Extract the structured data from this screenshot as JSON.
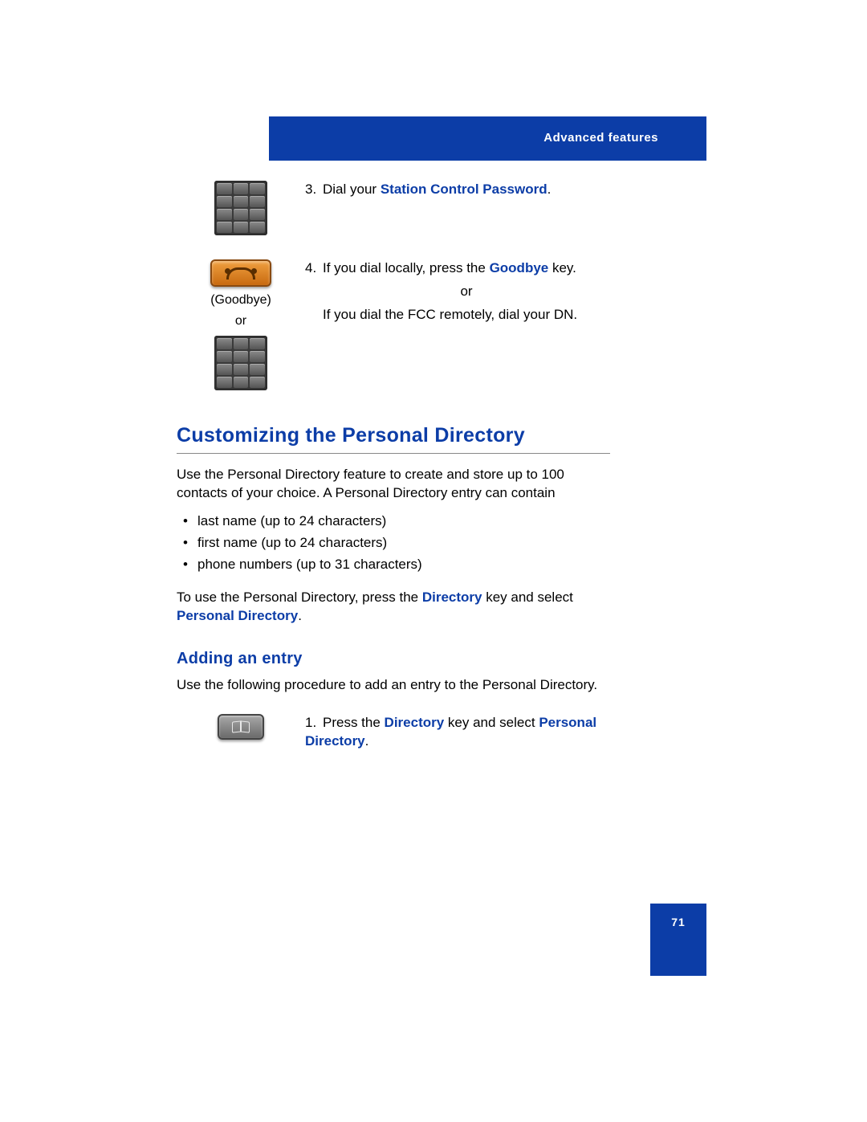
{
  "header": {
    "title": "Advanced features"
  },
  "steps": {
    "s3": {
      "num": "3.",
      "pre": "Dial your ",
      "bold": "Station Control Password",
      "post": "."
    },
    "s4": {
      "num": "4.",
      "line1_pre": "If you dial locally, press the ",
      "line1_bold": "Goodbye",
      "line1_post": " key.",
      "or": "or",
      "line2": "If you dial the FCC remotely, dial your DN.",
      "caption_goodbye": "(Goodbye)",
      "caption_or": "or"
    }
  },
  "section": {
    "title": "Customizing the Personal Directory",
    "intro": "Use the Personal Directory feature to create and store up to 100 contacts of your choice. A Personal Directory entry can contain",
    "bullets": [
      "last name (up to 24 characters)",
      "first name (up to 24 characters)",
      "phone numbers (up to 31 characters)"
    ],
    "usage_pre": "To use the Personal Directory, press the ",
    "usage_bold1": "Directory",
    "usage_mid": " key and select ",
    "usage_bold2": "Personal Directory",
    "usage_post": "."
  },
  "subsection": {
    "title": "Adding an entry",
    "intro": "Use the following procedure to add an entry to the Personal Directory.",
    "step1": {
      "num": "1.",
      "pre": "Press the ",
      "bold1": "Directory",
      "mid": " key and select ",
      "bold2": "Personal Directory",
      "post": "."
    }
  },
  "page_number": "71"
}
